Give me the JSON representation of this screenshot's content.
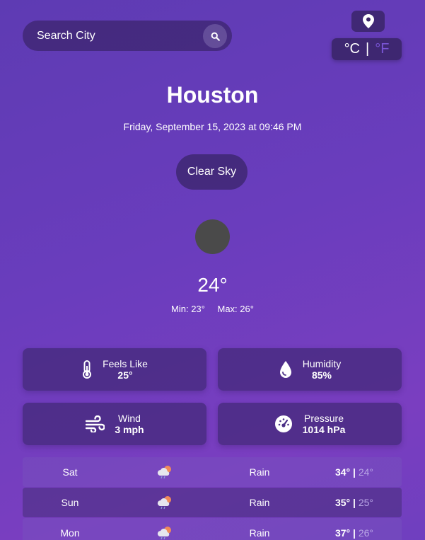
{
  "search": {
    "placeholder": "Search City"
  },
  "units": {
    "celsius": "°C",
    "separator": "|",
    "fahrenheit": "°F"
  },
  "city": "Houston",
  "datetime": "Friday, September 15, 2023 at 09:46 PM",
  "condition": "Clear Sky",
  "temperature": "24°",
  "min": "Min: 23°",
  "max": "Max: 26°",
  "details": [
    {
      "label": "Feels Like",
      "value": "25°",
      "icon": "thermometer-icon"
    },
    {
      "label": "Humidity",
      "value": "85%",
      "icon": "water-drop-icon"
    },
    {
      "label": "Wind",
      "value": "3 mph",
      "icon": "wind-icon"
    },
    {
      "label": "Pressure",
      "value": "1014 hPa",
      "icon": "gauge-icon"
    }
  ],
  "forecast": [
    {
      "day": "Sat",
      "desc": "Rain",
      "max": "34°",
      "sep": "|",
      "min": "24°",
      "icon": "rain-cloud-icon"
    },
    {
      "day": "Sun",
      "desc": "Rain",
      "max": "35°",
      "sep": "|",
      "min": "25°",
      "icon": "rain-cloud-icon"
    },
    {
      "day": "Mon",
      "desc": "Rain",
      "max": "37°",
      "sep": "|",
      "min": "26°",
      "icon": "rain-cloud-icon"
    }
  ],
  "colors": {
    "accent": "#7a55d6",
    "background": "#6a3dbd"
  }
}
